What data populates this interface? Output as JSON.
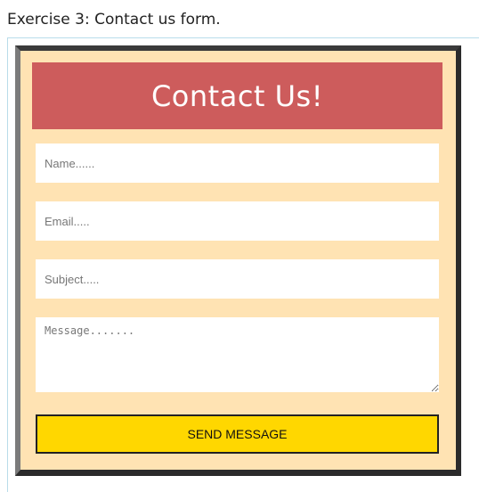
{
  "page": {
    "exercise_title": "Exercise 3: Contact us form."
  },
  "form": {
    "title": "Contact Us!",
    "name_placeholder": "Name......",
    "email_placeholder": "Email.....",
    "subject_placeholder": "Subject.....",
    "message_placeholder": "Message.......",
    "submit_label": "SEND MESSAGE"
  },
  "colors": {
    "form_background": "#ffe3b3",
    "header_background": "#cd5c5c",
    "button_background": "#ffd700",
    "border": "#2b2b2b"
  }
}
